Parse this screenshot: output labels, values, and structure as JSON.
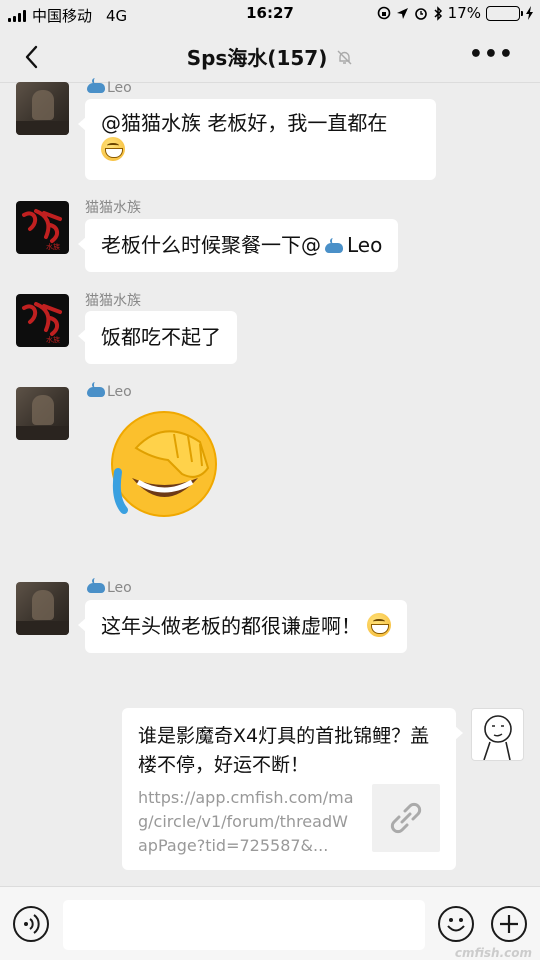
{
  "status_bar": {
    "carrier": "中国移动",
    "network": "4G",
    "time": "16:27",
    "battery_percent": "17%",
    "battery_level": 0.17,
    "battery_color": "#e04040"
  },
  "nav": {
    "title": "Sps海水(157)",
    "back_icon": "chevron-left-icon",
    "mute_icon": "bell-slash-icon",
    "more_icon": "more-icon"
  },
  "messages": [
    {
      "sender": "Leo",
      "text": "@猫猫水族 老板好，我一直都在",
      "emoji": "grin"
    },
    {
      "sender": "猫猫水族",
      "text": "老板什么时候聚餐一下@",
      "mention": "Leo"
    },
    {
      "sender": "猫猫水族",
      "text": "饭都吃不起了"
    },
    {
      "sender": "Leo",
      "sticker": "facepalm-laugh"
    },
    {
      "sender": "Leo",
      "text": "这年头做老板的都很谦虚啊！",
      "emoji": "grin"
    }
  ],
  "link_card": {
    "title": "谁是影魔奇X4灯具的首批锦鲤？盖楼不停，好运不断！",
    "url": "https://app.cmfish.com/mag/circle/v1/forum/threadWapPage?tid=725587&..."
  },
  "input_bar": {
    "voice_icon": "voice-icon",
    "emoji_icon": "emoji-icon",
    "plus_icon": "plus-icon"
  },
  "watermark": "cmfish.com"
}
